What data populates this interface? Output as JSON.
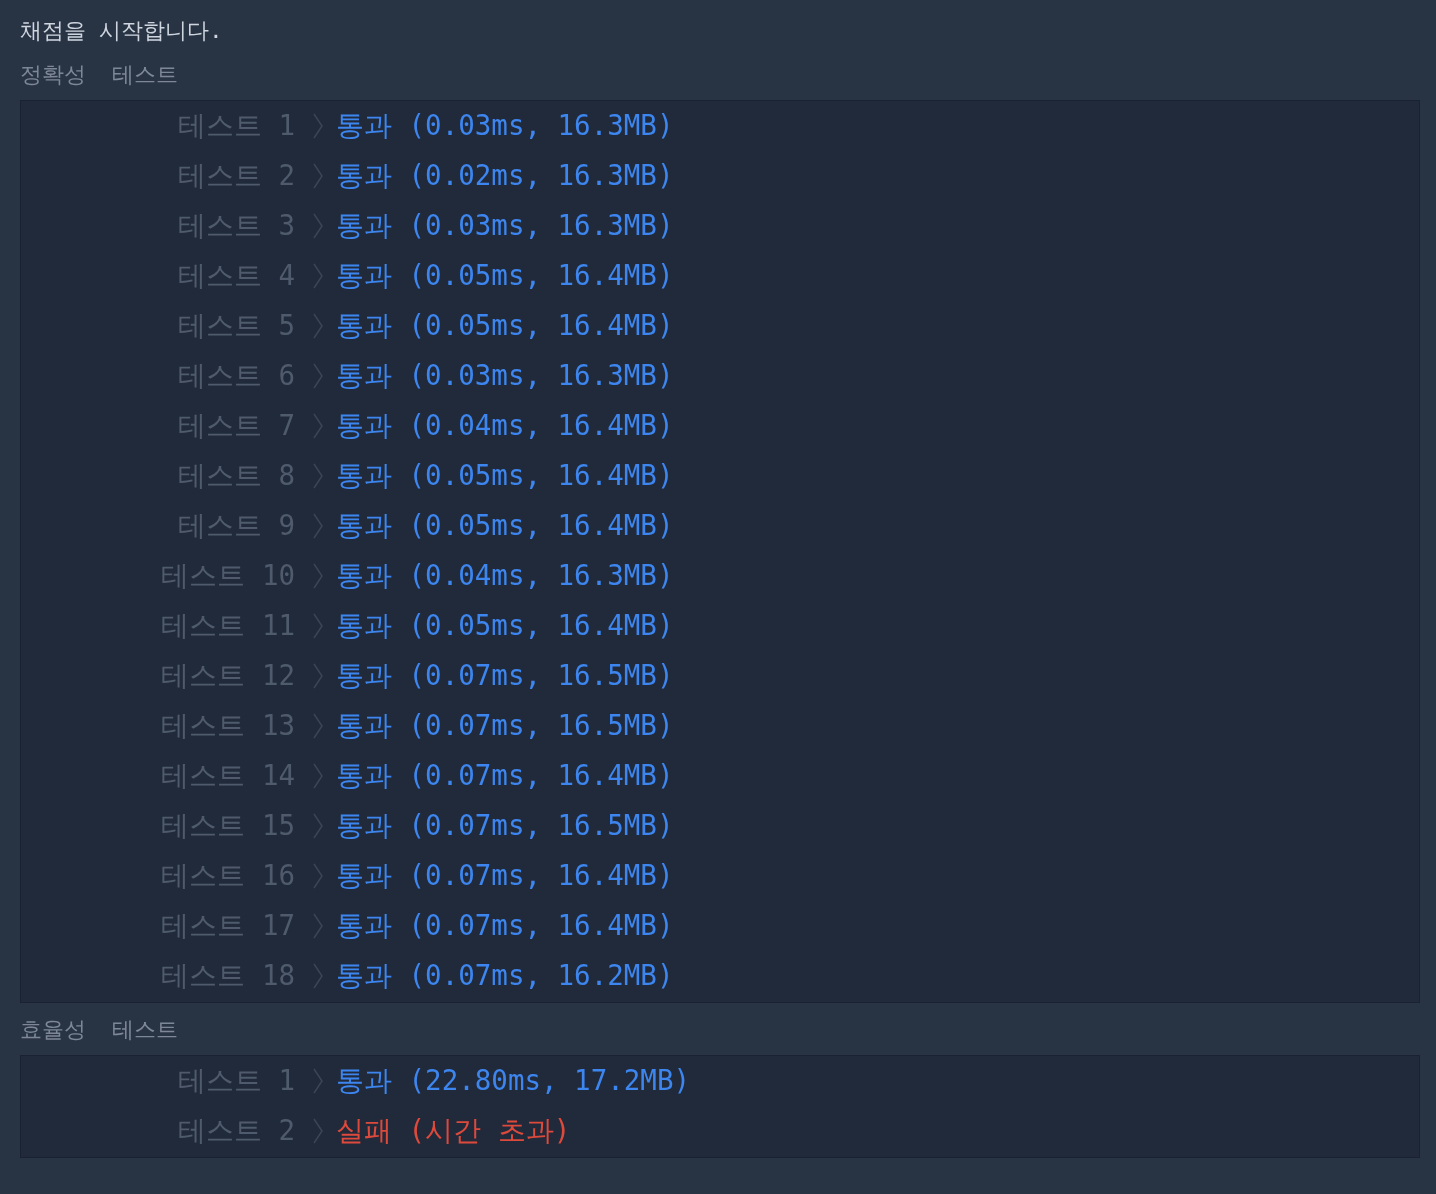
{
  "heading": "채점을 시작합니다.",
  "sections": [
    {
      "title": "정확성  테스트",
      "tests": [
        {
          "label": "테스트 1",
          "kind": "pass",
          "result": "통과 (0.03ms, 16.3MB)"
        },
        {
          "label": "테스트 2",
          "kind": "pass",
          "result": "통과 (0.02ms, 16.3MB)"
        },
        {
          "label": "테스트 3",
          "kind": "pass",
          "result": "통과 (0.03ms, 16.3MB)"
        },
        {
          "label": "테스트 4",
          "kind": "pass",
          "result": "통과 (0.05ms, 16.4MB)"
        },
        {
          "label": "테스트 5",
          "kind": "pass",
          "result": "통과 (0.05ms, 16.4MB)"
        },
        {
          "label": "테스트 6",
          "kind": "pass",
          "result": "통과 (0.03ms, 16.3MB)"
        },
        {
          "label": "테스트 7",
          "kind": "pass",
          "result": "통과 (0.04ms, 16.4MB)"
        },
        {
          "label": "테스트 8",
          "kind": "pass",
          "result": "통과 (0.05ms, 16.4MB)"
        },
        {
          "label": "테스트 9",
          "kind": "pass",
          "result": "통과 (0.05ms, 16.4MB)"
        },
        {
          "label": "테스트 10",
          "kind": "pass",
          "result": "통과 (0.04ms, 16.3MB)"
        },
        {
          "label": "테스트 11",
          "kind": "pass",
          "result": "통과 (0.05ms, 16.4MB)"
        },
        {
          "label": "테스트 12",
          "kind": "pass",
          "result": "통과 (0.07ms, 16.5MB)"
        },
        {
          "label": "테스트 13",
          "kind": "pass",
          "result": "통과 (0.07ms, 16.5MB)"
        },
        {
          "label": "테스트 14",
          "kind": "pass",
          "result": "통과 (0.07ms, 16.4MB)"
        },
        {
          "label": "테스트 15",
          "kind": "pass",
          "result": "통과 (0.07ms, 16.5MB)"
        },
        {
          "label": "테스트 16",
          "kind": "pass",
          "result": "통과 (0.07ms, 16.4MB)"
        },
        {
          "label": "테스트 17",
          "kind": "pass",
          "result": "통과 (0.07ms, 16.4MB)"
        },
        {
          "label": "테스트 18",
          "kind": "pass",
          "result": "통과 (0.07ms, 16.2MB)"
        }
      ]
    },
    {
      "title": "효율성  테스트",
      "tests": [
        {
          "label": "테스트 1",
          "kind": "pass",
          "result": "통과 (22.80ms, 17.2MB)"
        },
        {
          "label": "테스트 2",
          "kind": "fail",
          "result": "실패 (시간 초과)"
        }
      ]
    }
  ]
}
